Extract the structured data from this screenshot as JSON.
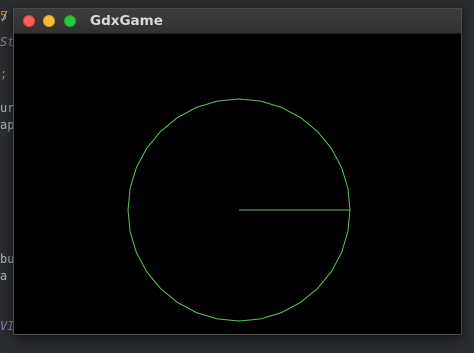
{
  "window": {
    "title": "GdxGame"
  },
  "scene": {
    "shape_color": "#5ec15e",
    "background_color": "#000000",
    "circle_segments": 32
  },
  "background_editor": {
    "fragments": [
      "5",
      "/",
      "St",
      ";",
      "ur",
      "ap",
      "bu",
      "a (",
      "VII"
    ]
  }
}
